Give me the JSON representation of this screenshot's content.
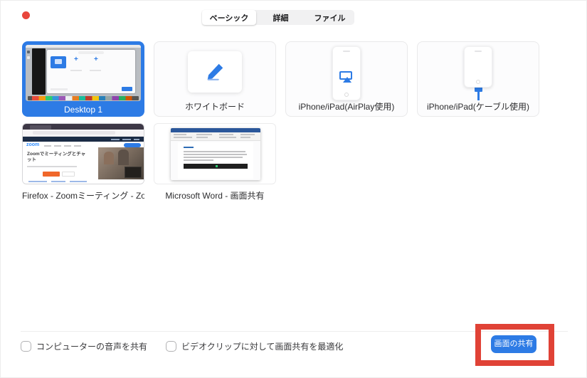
{
  "colors": {
    "accent_blue": "#2d7be5",
    "annotation_red": "#e04236",
    "close_button_red": "#e8463c",
    "word_title_blue": "#2b579a",
    "firefox_orange": "#f0672a"
  },
  "tabs": {
    "basic": "ベーシック",
    "advanced": "詳細",
    "files": "ファイル"
  },
  "tiles": {
    "row1": [
      {
        "label": "Desktop 1",
        "selected": true
      },
      {
        "label": "ホワイトボード",
        "selected": false
      },
      {
        "label": "iPhone/iPad(AirPlay使用)",
        "selected": false
      },
      {
        "label": "iPhone/iPad(ケーブル使用)",
        "selected": false
      }
    ],
    "row2": [
      {
        "label": "Firefox - Zoomミーティング - Zoom..."
      },
      {
        "label": "Microsoft Word - 画面共有"
      }
    ]
  },
  "thumbnails": {
    "firefox": {
      "logo": "zoom",
      "heading": "Zoomでミーティングとチャット"
    }
  },
  "footer": {
    "checkboxes": [
      {
        "label": "コンピューターの音声を共有",
        "checked": false
      },
      {
        "label": "ビデオクリップに対して画面共有を最適化",
        "checked": false
      }
    ],
    "share_button": "画面の共有"
  }
}
